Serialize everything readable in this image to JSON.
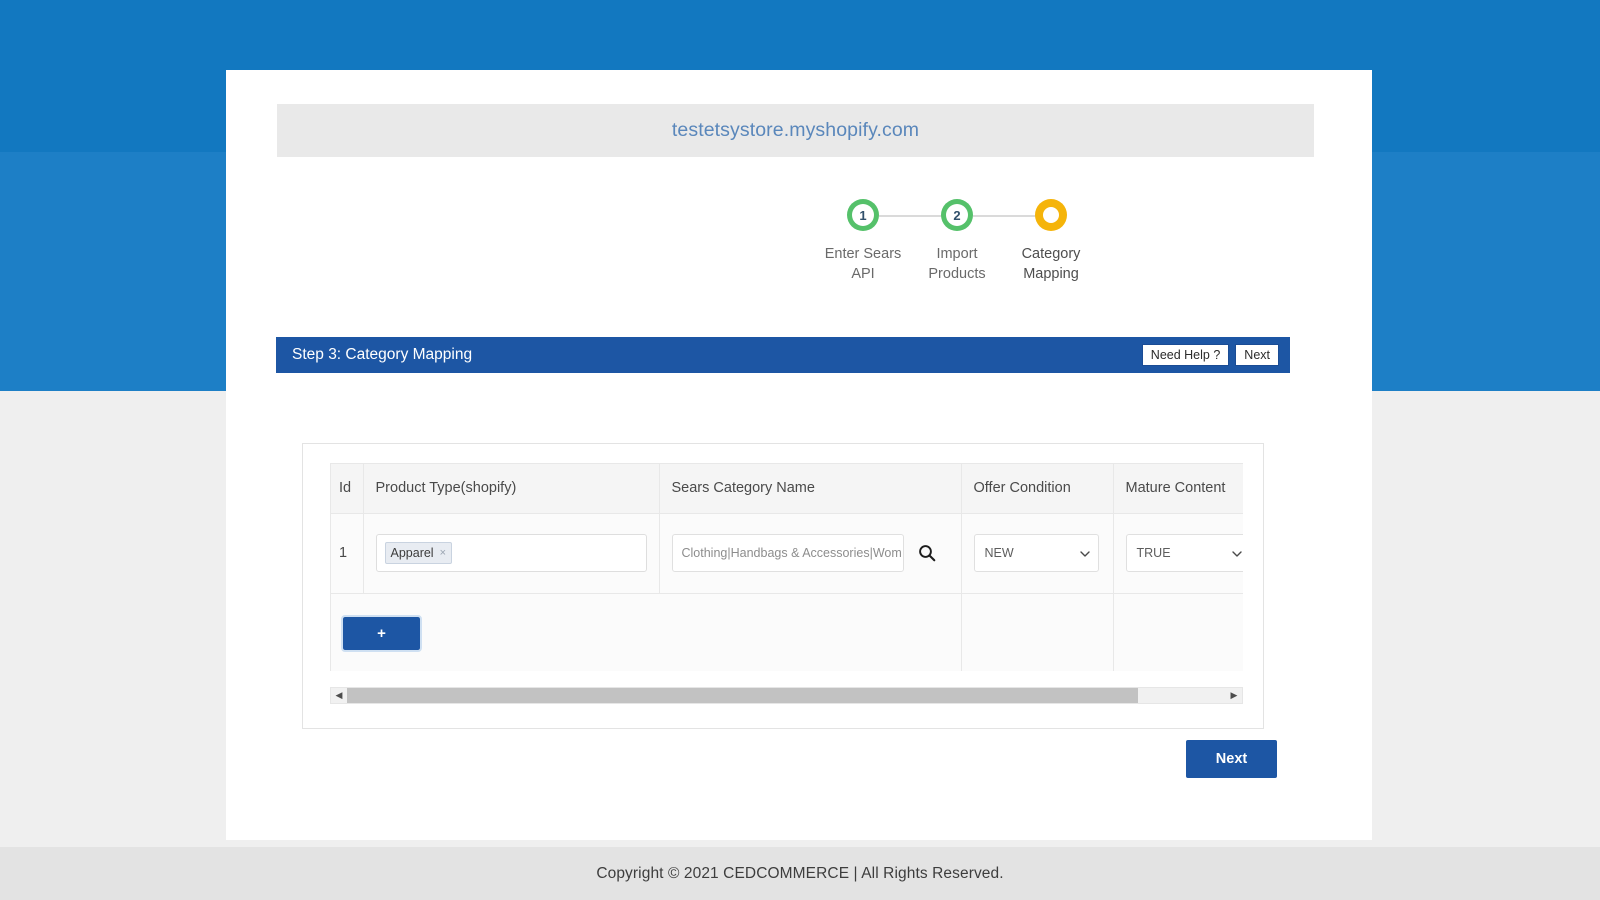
{
  "store": {
    "url": "testetsystore.myshopify.com"
  },
  "stepper": {
    "steps": [
      {
        "number": "1",
        "label_line1": "Enter Sears",
        "label_line2": "API",
        "state": "done"
      },
      {
        "number": "2",
        "label_line1": "Import",
        "label_line2": "Products",
        "state": "done"
      },
      {
        "number": "",
        "label_line1": "Category",
        "label_line2": "Mapping",
        "state": "current"
      }
    ],
    "colors": {
      "done": "#55c16a",
      "current": "#f5b40a",
      "line": "#dadada"
    }
  },
  "step_header": {
    "title": "Step 3: Category Mapping",
    "need_help_label": "Need Help ?",
    "next_label": "Next",
    "background": "#1d56a4"
  },
  "mapping_table": {
    "columns": [
      "Id",
      "Product Type(shopify)",
      "Sears Category Name",
      "Offer Condition",
      "Mature Content"
    ],
    "rows": [
      {
        "id": "1",
        "product_type_tag": "Apparel",
        "product_type_remove": "×",
        "sears_category": "Clothing|Handbags & Accessories|Wom",
        "offer_condition": "NEW",
        "mature_content": "TRUE"
      }
    ],
    "add_button_label": "+",
    "search_icon": "search-icon"
  },
  "scrollbar": {
    "left_arrow": "◀",
    "right_arrow": "▶",
    "thumb_percent": "90"
  },
  "footer": {
    "next_label": "Next",
    "copyright": "Copyright © 2021 CEDCOMMERCE | All Rights Reserved."
  },
  "theme": {
    "banner_blue": "#1d7fc6",
    "primary_blue": "#1d56a4",
    "page_grey": "#efefef"
  }
}
